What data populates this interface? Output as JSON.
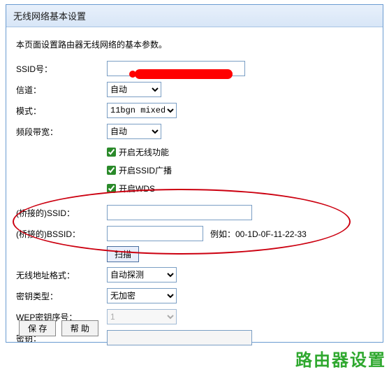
{
  "panel": {
    "title": "无线网络基本设置",
    "description": "本页面设置路由器无线网络的基本参数。"
  },
  "labels": {
    "ssid": "SSID号：",
    "channel": "信道：",
    "mode": "模式：",
    "bandwidth": "频段带宽：",
    "bridge_ssid": "(桥接的)SSID：",
    "bridge_bssid": "(桥接的)BSSID：",
    "addr_format": "无线地址格式：",
    "key_type": "密钥类型：",
    "wep_key_index": "WEP密钥序号：",
    "key": "密钥："
  },
  "values": {
    "ssid": "",
    "channel": "自动",
    "mode": "11bgn mixed",
    "bandwidth": "自动",
    "bridge_ssid": "",
    "bridge_bssid": "",
    "addr_format": "自动探测",
    "key_type": "无加密",
    "wep_key_index": "1",
    "key": ""
  },
  "checkboxes": {
    "enable_wifi": "开启无线功能",
    "enable_ssid_broadcast": "开启SSID广播",
    "enable_wds": "开启WDS"
  },
  "example": "例如：00-1D-0F-11-22-33",
  "buttons": {
    "scan": "扫描",
    "save": "保 存",
    "help": "帮 助"
  },
  "watermark": "路由器设置"
}
